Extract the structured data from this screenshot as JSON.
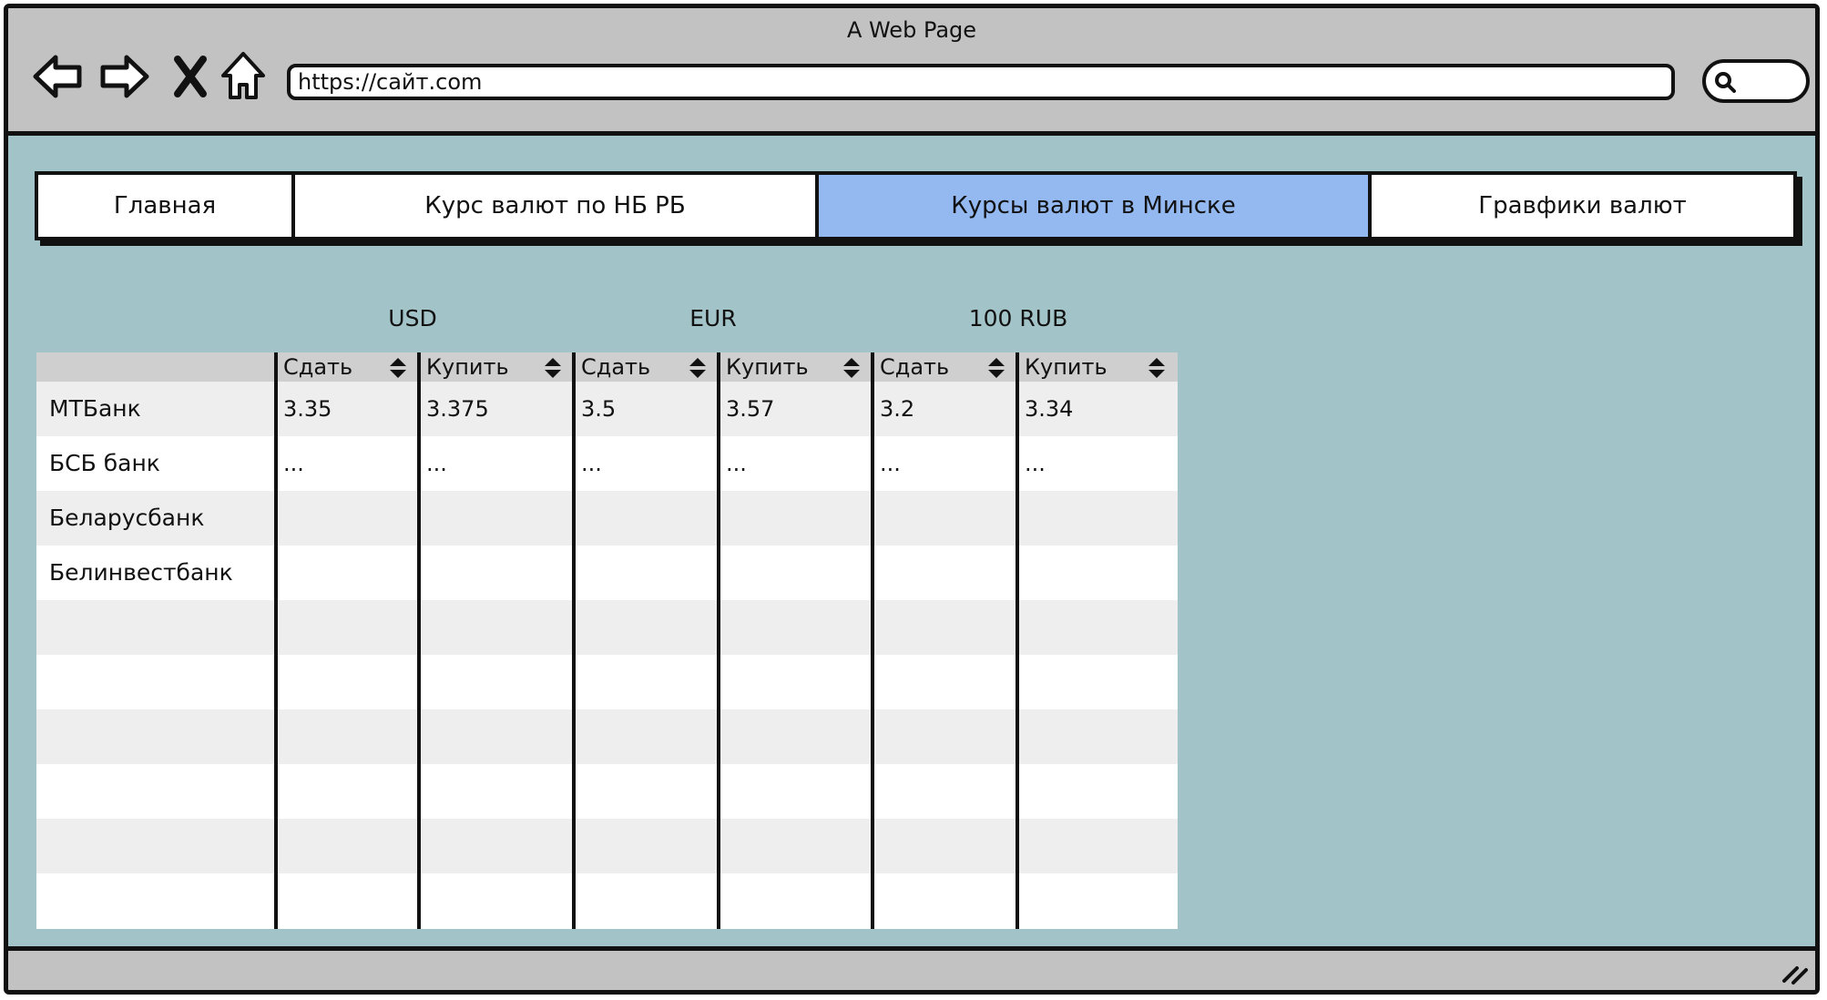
{
  "window": {
    "title": "A Web Page"
  },
  "browser": {
    "url": "https://сайт.com",
    "buttons": [
      "back-arrow-icon",
      "forward-arrow-icon",
      "close-x-icon",
      "home-icon"
    ],
    "search_icon": "magnifier-icon"
  },
  "tabs": [
    {
      "label": "Главная",
      "active": false
    },
    {
      "label": "Курс валют по НБ РБ",
      "active": false
    },
    {
      "label": "Курсы валют в Минске",
      "active": true
    },
    {
      "label": "Гравфики валют",
      "active": false
    }
  ],
  "colors": {
    "page_bg": "#a2c3c8",
    "active_tab": "#93b9f0",
    "chrome": "#c2c2c2"
  },
  "rates": {
    "currencies": [
      "USD",
      "EUR",
      "100 RUB"
    ],
    "column_headers": [
      "Сдать",
      "Купить",
      "Сдать",
      "Купить",
      "Сдать",
      "Купить"
    ],
    "rows": [
      {
        "bank": "МТБанк",
        "values": [
          "3.35",
          "3.375",
          "3.5",
          "3.57",
          "3.2",
          "3.34"
        ]
      },
      {
        "bank": "БСБ банк",
        "values": [
          "...",
          "...",
          "...",
          "...",
          "...",
          "..."
        ]
      },
      {
        "bank": "Беларусбанк",
        "values": [
          "",
          "",
          "",
          "",
          "",
          ""
        ]
      },
      {
        "bank": "Белинвестбанк",
        "values": [
          "",
          "",
          "",
          "",
          "",
          ""
        ]
      },
      {
        "bank": "",
        "values": [
          "",
          "",
          "",
          "",
          "",
          ""
        ]
      },
      {
        "bank": "",
        "values": [
          "",
          "",
          "",
          "",
          "",
          ""
        ]
      },
      {
        "bank": "",
        "values": [
          "",
          "",
          "",
          "",
          "",
          ""
        ]
      },
      {
        "bank": "",
        "values": [
          "",
          "",
          "",
          "",
          "",
          ""
        ]
      },
      {
        "bank": "",
        "values": [
          "",
          "",
          "",
          "",
          "",
          ""
        ]
      },
      {
        "bank": "",
        "values": [
          "",
          "",
          "",
          "",
          "",
          ""
        ]
      }
    ]
  }
}
